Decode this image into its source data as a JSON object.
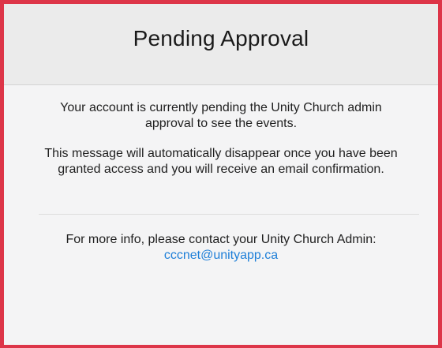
{
  "dialog": {
    "title": "Pending Approval",
    "message_1": "Your account is currently pending the Unity Church admin approval to see the events.",
    "message_2": "This message will automatically disappear once you have been granted access and you will receive an email confirmation.",
    "contact_text": "For more info, please contact your Unity Church Admin:",
    "contact_email": "cccnet@unityapp.ca"
  },
  "colors": {
    "border": "#dd3548",
    "link": "#1e7fd8",
    "header_bg": "#ebebeb",
    "body_bg": "#f4f4f5"
  }
}
